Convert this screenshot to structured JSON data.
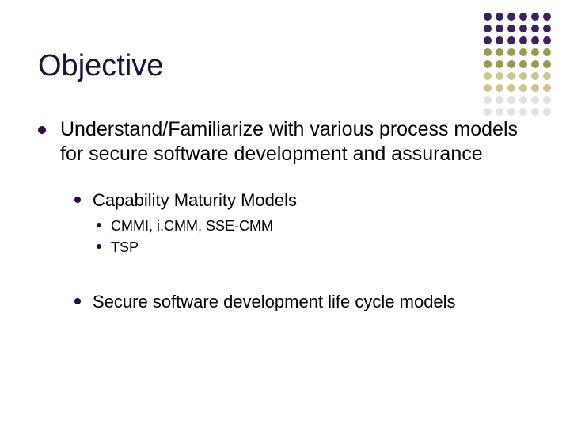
{
  "title": "Objective",
  "bullets": {
    "b1": "Understand/Familiarize with various process models for secure software development and assurance",
    "b2": "Capability Maturity Models",
    "b2a": "CMMI, i.CMM, SSE-CMM",
    "b2b": "TSP",
    "b3": "Secure software development life cycle models"
  },
  "colors": {
    "accent": "#2b0a4a",
    "dot_purple_dark": "#3a235c",
    "dot_olive": "#9a9a4a",
    "dot_olive_light": "#c8c88a",
    "dot_gray": "#d8d8d8"
  }
}
